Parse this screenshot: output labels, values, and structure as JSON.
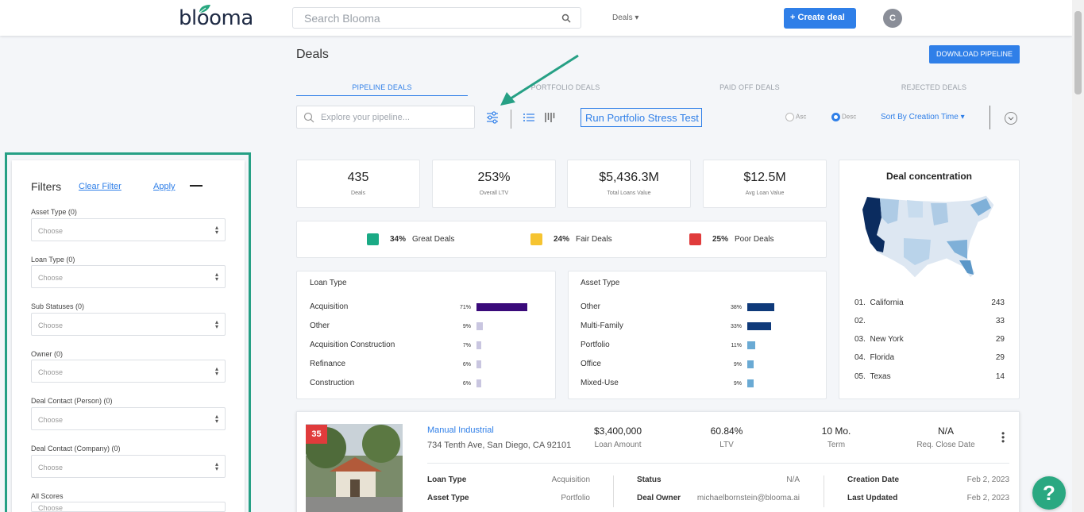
{
  "app": {
    "logo": "blooma",
    "search_placeholder": "Search Blooma",
    "deals_menu": "Deals",
    "create_deal": "Create deal",
    "avatar_initial": "C"
  },
  "page": {
    "title": "Deals",
    "download": "DOWNLOAD PIPELINE",
    "tabs": [
      "PIPELINE DEALS",
      "PORTFOLIO DEALS",
      "PAID OFF DEALS",
      "REJECTED DEALS"
    ],
    "active_tab": "PIPELINE DEALS",
    "pipeline_search_placeholder": "Explore your pipeline...",
    "stress_test": "Run Portfolio Stress Test",
    "sort_asc": "Asc",
    "sort_desc": "Desc",
    "sort_desc_selected": true,
    "sort_by": "Sort By Creation Time"
  },
  "filters": {
    "title": "Filters",
    "clear": "Clear Filter",
    "apply": "Apply",
    "fields": [
      {
        "label": "Asset Type (0)",
        "value": "Choose"
      },
      {
        "label": "Loan Type (0)",
        "value": "Choose"
      },
      {
        "label": "Sub Statuses (0)",
        "value": "Choose"
      },
      {
        "label": "Owner (0)",
        "value": "Choose"
      },
      {
        "label": "Deal Contact (Person) (0)",
        "value": "Choose"
      },
      {
        "label": "Deal Contact (Company) (0)",
        "value": "Choose"
      },
      {
        "label": "All Scores",
        "value": "Choose"
      }
    ]
  },
  "stats": [
    {
      "value": "435",
      "label": "Deals"
    },
    {
      "value": "253%",
      "label": "Overall LTV"
    },
    {
      "value": "$5,436.3M",
      "label": "Total Loans Value"
    },
    {
      "value": "$12.5M",
      "label": "Avg Loan Value"
    }
  ],
  "quality": [
    {
      "pct": "34%",
      "label": "Great Deals",
      "color": "#1aaa85"
    },
    {
      "pct": "24%",
      "label": "Fair Deals",
      "color": "#f6c431"
    },
    {
      "pct": "25%",
      "label": "Poor Deals",
      "color": "#e03b3b"
    }
  ],
  "loan_type": {
    "title": "Loan Type",
    "color_main": "#3a0a7a",
    "color_minor": "#c9c6e0",
    "rows": [
      {
        "label": "Acquisition",
        "pct": "71%",
        "value": 71
      },
      {
        "label": "Other",
        "pct": "9%",
        "value": 9
      },
      {
        "label": "Acquisition Construction",
        "pct": "7%",
        "value": 7
      },
      {
        "label": "Refinance",
        "pct": "6%",
        "value": 6
      },
      {
        "label": "Construction",
        "pct": "6%",
        "value": 6
      }
    ]
  },
  "asset_type": {
    "title": "Asset Type",
    "color_main": "#0f3a7a",
    "color_minor": "#6aaad4",
    "rows": [
      {
        "label": "Other",
        "pct": "38%",
        "value": 38
      },
      {
        "label": "Multi-Family",
        "pct": "33%",
        "value": 33
      },
      {
        "label": "Portfolio",
        "pct": "11%",
        "value": 11
      },
      {
        "label": "Office",
        "pct": "9%",
        "value": 9
      },
      {
        "label": "Mixed-Use",
        "pct": "9%",
        "value": 9
      }
    ]
  },
  "concentration": {
    "title": "Deal concentration",
    "rows": [
      {
        "rank": "01.",
        "state": "California",
        "count": "243"
      },
      {
        "rank": "02.",
        "state": "",
        "count": "33"
      },
      {
        "rank": "03.",
        "state": "New York",
        "count": "29"
      },
      {
        "rank": "04.",
        "state": "Florida",
        "count": "29"
      },
      {
        "rank": "05.",
        "state": "Texas",
        "count": "14"
      }
    ]
  },
  "deal": {
    "score": "35",
    "name": "Manual Industrial",
    "address": "734 Tenth Ave, San Diego, CA 92101",
    "metrics": [
      {
        "value": "$3,400,000",
        "label": "Loan Amount"
      },
      {
        "value": "60.84%",
        "label": "LTV"
      },
      {
        "value": "10 Mo.",
        "label": "Term"
      },
      {
        "value": "N/A",
        "label": "Req. Close Date"
      }
    ],
    "details": [
      {
        "key": "Loan Type",
        "value": "Acquisition"
      },
      {
        "key": "Asset Type",
        "value": "Portfolio"
      },
      {
        "key": "Status",
        "value": "N/A"
      },
      {
        "key": "Deal Owner",
        "value": "michaelbornstein@blooma.ai"
      },
      {
        "key": "Creation Date",
        "value": "Feb 2, 2023"
      },
      {
        "key": "Last Updated",
        "value": "Feb 2, 2023"
      }
    ]
  },
  "help": "?"
}
